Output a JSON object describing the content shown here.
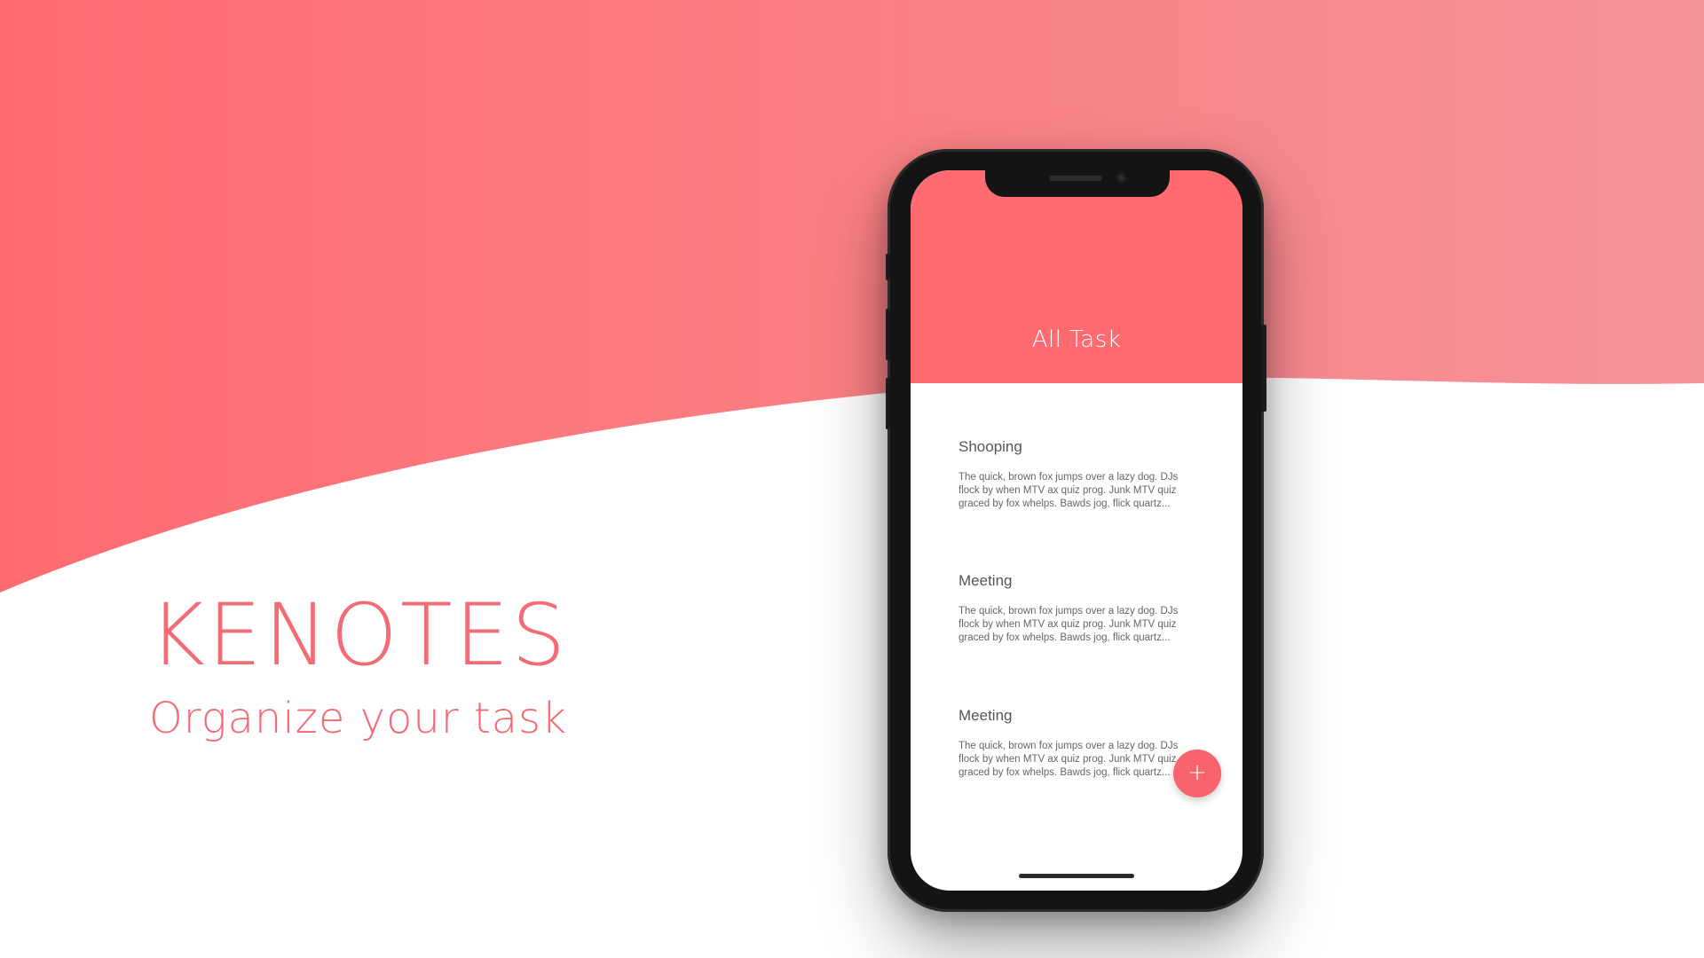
{
  "brand": {
    "title": "KENOTES",
    "tagline": "Organize your task"
  },
  "colors": {
    "accent": "#ff6b71",
    "brand_text": "#f36c74",
    "fab": "#f9636b",
    "wave_start": "#ff6b71",
    "wave_end": "#f5939a"
  },
  "app": {
    "header_title": "All Task",
    "tasks": [
      {
        "title": "Shooping",
        "body": "The quick, brown fox jumps over a lazy dog. DJs flock by when MTV ax quiz prog. Junk MTV quiz graced by fox whelps. Bawds jog, flick quartz..."
      },
      {
        "title": "Meeting",
        "body": "The quick, brown fox jumps over a lazy dog. DJs flock by when MTV ax quiz prog. Junk MTV quiz graced by fox whelps. Bawds jog, flick quartz..."
      },
      {
        "title": "Meeting",
        "body": "The quick, brown fox jumps over a lazy dog. DJs flock by when MTV ax quiz prog. Junk MTV quiz graced by fox whelps. Bawds jog, flick quartz..."
      }
    ],
    "fab_label": "+",
    "fab_icon": "plus-icon"
  }
}
